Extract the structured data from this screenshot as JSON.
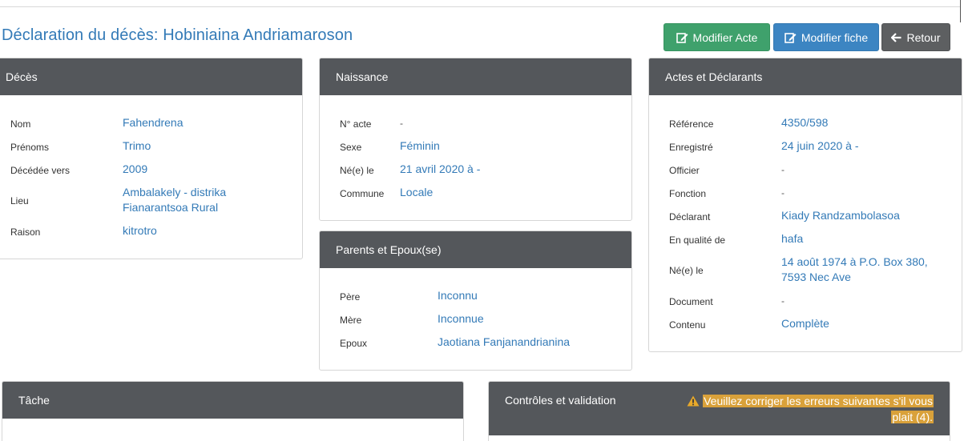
{
  "page": {
    "title": "Déclaration du décès: Hobiniaina Andriamaroson"
  },
  "toolbar": {
    "edit_act_label": "Modifier Acte",
    "edit_record_label": "Modifier fiche",
    "back_label": "Retour"
  },
  "colors": {
    "accent": "#337ab7",
    "panel_header": "#54575b",
    "success": "#3fa16c",
    "primary": "#3c85c2",
    "dark": "#5d5f61",
    "warning": "#d9a13a"
  },
  "deces": {
    "title": "Décès",
    "fields": [
      {
        "label": "Nom",
        "value": "Fahendrena"
      },
      {
        "label": "Prénoms",
        "value": "Trimo"
      },
      {
        "label": "Décédée vers",
        "value": "2009"
      },
      {
        "label": "Lieu",
        "value_line1": "Ambalakely - distrika",
        "value_line2": "Fianarantsoa Rural"
      },
      {
        "label": "Raison",
        "value": "kitrotro"
      }
    ]
  },
  "naissance": {
    "title": "Naissance",
    "fields": [
      {
        "label": "N° acte",
        "value": "-"
      },
      {
        "label": "Sexe",
        "value": "Féminin"
      },
      {
        "label": "Né(e) le",
        "value": "21 avril 2020 à -"
      },
      {
        "label": "Commune",
        "value": "Locale"
      }
    ]
  },
  "parents": {
    "title": "Parents et Epoux(se)",
    "fields": [
      {
        "label": "Père",
        "value": "Inconnu"
      },
      {
        "label": "Mère",
        "value": "Inconnue"
      },
      {
        "label": "Epoux",
        "value": "Jaotiana Fanjanandrianina"
      }
    ]
  },
  "actes": {
    "title": "Actes et Déclarants",
    "fields": [
      {
        "label": "Référence",
        "value": "4350/598"
      },
      {
        "label": "Enregistré",
        "value": "24 juin 2020 à -"
      },
      {
        "label": "Officier",
        "value": "-"
      },
      {
        "label": "Fonction",
        "value": "-"
      },
      {
        "label": "Déclarant",
        "value": "Kiady Randzambolasoa"
      },
      {
        "label": "En qualité de",
        "value": "hafa"
      },
      {
        "label": "Né(e) le",
        "value_line1": "14 août 1974 à P.O. Box 380,",
        "value_line2": "7593 Nec Ave"
      },
      {
        "label": "Document",
        "value": "-"
      },
      {
        "label": "Contenu",
        "value": "Complète"
      }
    ]
  },
  "tache": {
    "title": "Tâche"
  },
  "controles": {
    "title": "Contrôles et validation",
    "alert_line1": "Veuillez corriger les erreurs suivantes s'il vous",
    "alert_line2": "plait (4).",
    "alert_icon": "warning-icon"
  }
}
